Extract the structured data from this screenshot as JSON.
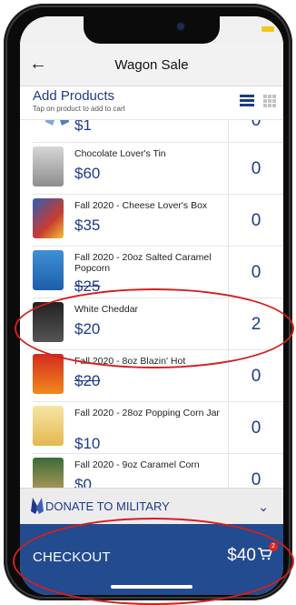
{
  "header": {
    "title": "Wagon Sale",
    "back_icon": "←"
  },
  "section": {
    "title": "Add Products",
    "subtitle": "Tap on product to add to cart",
    "list_view_icon": "list-icon",
    "grid_view_icon": "grid-icon"
  },
  "products": [
    {
      "name": "",
      "price": "$1",
      "qty": "0"
    },
    {
      "name": "Chocolate Lover's Tin",
      "price": "$60",
      "qty": "0"
    },
    {
      "name": "Fall 2020 - Cheese Lover's Box",
      "price": "$35",
      "qty": "0"
    },
    {
      "name": "Fall 2020 - 20oz Salted Caramel Popcorn",
      "price": "$25",
      "qty": "0"
    },
    {
      "name": "White Cheddar",
      "price": "$20",
      "qty": "2"
    },
    {
      "name": "Fall 2020 - 8oz Blazin' Hot",
      "price": "$20",
      "qty": "0"
    },
    {
      "name": "Fall 2020 - 28oz Popping Corn Jar",
      "price": "$10",
      "qty": "0"
    },
    {
      "name": "Fall 2020 - 9oz Caramel Corn",
      "price": "$0",
      "qty": "0"
    }
  ],
  "donate": {
    "label": "DONATE TO MILITARY"
  },
  "checkout": {
    "label": "CHECKOUT",
    "total": "$40",
    "cart_count": "2"
  },
  "colors": {
    "brand": "#1e3a8a",
    "checkout_bg": "#234b8f",
    "annotation": "#d41f1f"
  }
}
